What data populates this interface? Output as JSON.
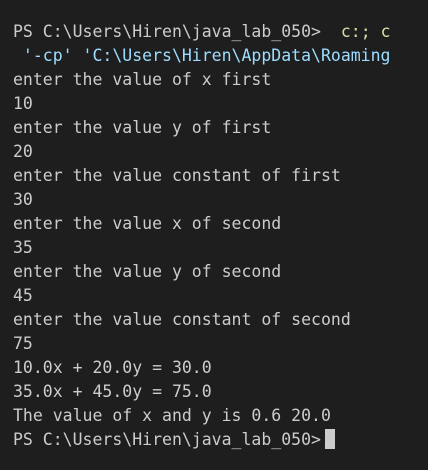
{
  "terminal": {
    "prompt": "PS C:\\Users\\Hiren\\java_lab_050>",
    "command_part1": "c:; c",
    "command_part2": " '-cp' 'C:\\Users\\Hiren\\AppData\\Roaming",
    "output": [
      "enter the value of x first",
      "10",
      "enter the value y of first",
      "20",
      "enter the value constant of first",
      "30",
      "enter the value x of second",
      "35",
      "enter the value y of second",
      "45",
      "enter the value constant of second",
      "75",
      "10.0x + 20.0y = 30.0",
      "35.0x + 45.0y = 75.0",
      "The value of x and y is 0.6 20.0"
    ],
    "final_prompt": "PS C:\\Users\\Hiren\\java_lab_050>"
  }
}
